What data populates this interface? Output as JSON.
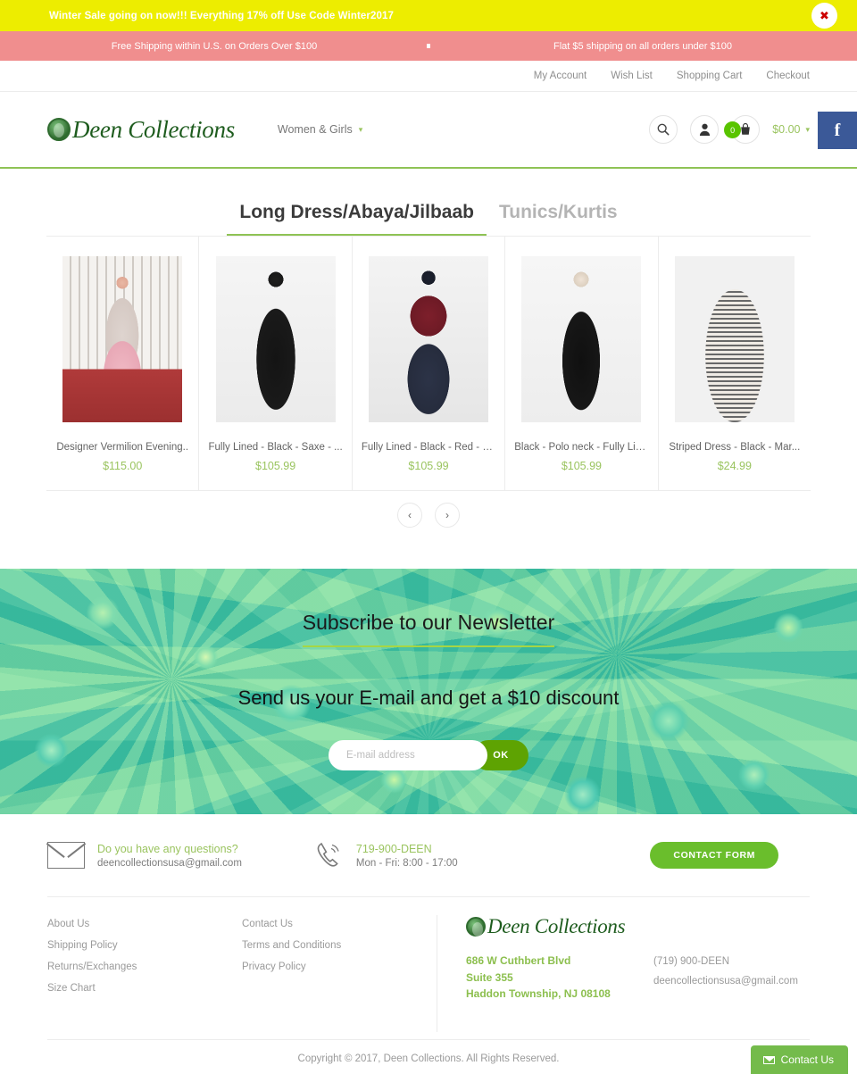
{
  "promo": {
    "text": "Winter Sale going on now!!! Everything 17% off Use Code Winter2017",
    "close_icon": "close-icon",
    "close_glyph": "✖"
  },
  "shipping": {
    "left": "Free Shipping within U.S. on Orders Over $100",
    "right": "Flat $5 shipping on all orders under $100"
  },
  "utility_nav": {
    "items": [
      {
        "label": "My Account"
      },
      {
        "label": "Wish List"
      },
      {
        "label": "Shopping Cart"
      },
      {
        "label": "Checkout"
      }
    ]
  },
  "header": {
    "logo_text": "Deen Collections",
    "nav": [
      {
        "label": "Women & Girls",
        "caret": "▾"
      }
    ],
    "search_icon": "search-icon",
    "account_icon": "user-icon",
    "cart_icon": "cart-icon",
    "cart_count": "0",
    "cart_total": "$0.00",
    "cart_caret": "▾",
    "facebook_glyph": "f"
  },
  "tabs": [
    {
      "label": "Long Dress/Abaya/Jilbaab",
      "active": true
    },
    {
      "label": "Tunics/Kurtis",
      "active": false
    }
  ],
  "products": [
    {
      "name": "Designer Vermilion Evening..",
      "price": "$115.00"
    },
    {
      "name": "Fully Lined - Black - Saxe - ...",
      "price": "$105.99"
    },
    {
      "name": "Fully Lined - Black - Red - P...",
      "price": "$105.99"
    },
    {
      "name": "Black - Polo neck - Fully Lin...",
      "price": "$105.99"
    },
    {
      "name": "Striped Dress - Black - Mar...",
      "price": "$24.99"
    }
  ],
  "carousel": {
    "prev_glyph": "‹",
    "next_glyph": "›"
  },
  "newsletter": {
    "title": "Subscribe to our Newsletter",
    "subtitle": "Send us your E-mail and get a $10 discount",
    "placeholder": "E-mail address",
    "value": "",
    "button": "OK"
  },
  "contact_strip": {
    "email_icon": "envelope-icon",
    "email_title": "Do you have any questions?",
    "email_value": "deencollectionsusa@gmail.com",
    "phone_icon": "phone-icon",
    "phone_title": "719-900-DEEN",
    "phone_hours": "Mon - Fri: 8:00 - 17:00",
    "button": "CONTACT FORM"
  },
  "footer": {
    "column_one": [
      {
        "label": "About Us"
      },
      {
        "label": "Shipping Policy"
      },
      {
        "label": "Returns/Exchanges"
      },
      {
        "label": "Size Chart"
      }
    ],
    "column_two": [
      {
        "label": "Contact Us"
      },
      {
        "label": "Terms and Conditions"
      },
      {
        "label": "Privacy Policy"
      }
    ],
    "logo_text": "Deen Collections",
    "address_line1": "686 W Cuthbert Blvd",
    "address_line2": "Suite 355",
    "address_line3": "Haddon Township, NJ 08108",
    "phone": "(719) 900-DEEN",
    "email": "deencollectionsusa@gmail.com"
  },
  "copyright": "Copyright © 2017, Deen Collections. All Rights Reserved.",
  "contact_tab": {
    "label": "Contact Us",
    "icon": "envelope-icon"
  },
  "colors": {
    "promo_yellow": "#eded00",
    "shipping_pink": "#f08e8e",
    "brand_green": "#8fc355",
    "price_green": "#9ac45f",
    "logo_green": "#1e5c1e",
    "facebook_blue": "#3b5998",
    "badge_green": "#59c400"
  }
}
